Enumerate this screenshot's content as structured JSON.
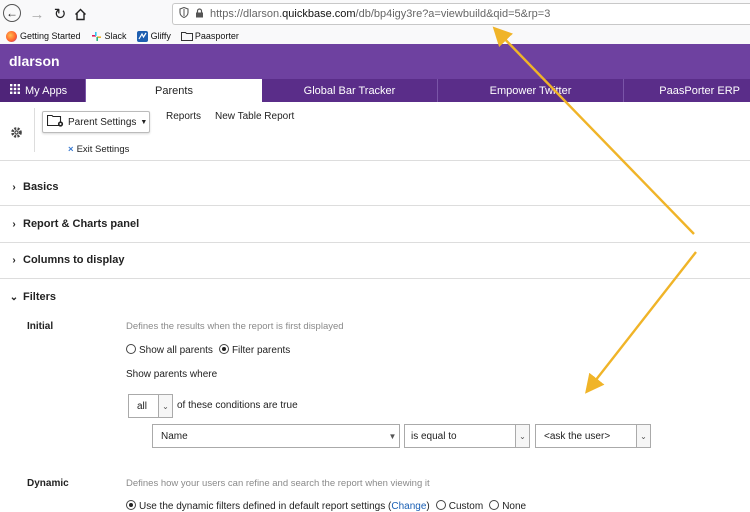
{
  "browser": {
    "url_prefix": "https://dlarson.",
    "url_domain": "quickbase.com",
    "url_suffix": "/db/bp4igy3re?a=viewbuild&qid=5&rp=3",
    "bookmarks": [
      {
        "label": "Getting Started",
        "icon": "firefox-icon"
      },
      {
        "label": "Slack",
        "icon": "slack-icon"
      },
      {
        "label": "Gliffy",
        "icon": "gliffy-icon"
      },
      {
        "label": "Paasporter",
        "icon": "folder-icon"
      }
    ]
  },
  "app": {
    "title": "dlarson",
    "my_apps": "My Apps",
    "tabs": [
      "Parents",
      "Global Bar Tracker",
      "Empower Twitter",
      "PaasPorter ERP"
    ]
  },
  "toolbar": {
    "settings_label": "Parent Settings",
    "reports": "Reports",
    "new_table_report": "New Table Report",
    "exit_settings": "Exit Settings"
  },
  "sections": {
    "basics": "Basics",
    "report_charts": "Report & Charts panel",
    "columns": "Columns to display",
    "filters": "Filters"
  },
  "filters": {
    "initial_label": "Initial",
    "initial_desc": "Defines the results when the report is first displayed",
    "show_all": "Show all parents",
    "filter_parents": "Filter parents",
    "show_where": "Show parents where",
    "match_value": "all",
    "match_suffix": "of these conditions are true",
    "field_value": "Name",
    "operator_value": "is equal to",
    "value_value": "<ask the user>",
    "dynamic_label": "Dynamic",
    "dynamic_desc": "Defines how your users can refine and search the report when viewing it",
    "dynamic_default": "Use the dynamic filters defined in default report settings (",
    "change_link": "Change",
    "dynamic_default_end": ")",
    "custom": "Custom",
    "none": "None"
  },
  "colors": {
    "purple": "#6e41a0",
    "tab_purple": "#5a2d89",
    "annotation_arrow": "#f0b428",
    "link": "#1a5fb4"
  }
}
